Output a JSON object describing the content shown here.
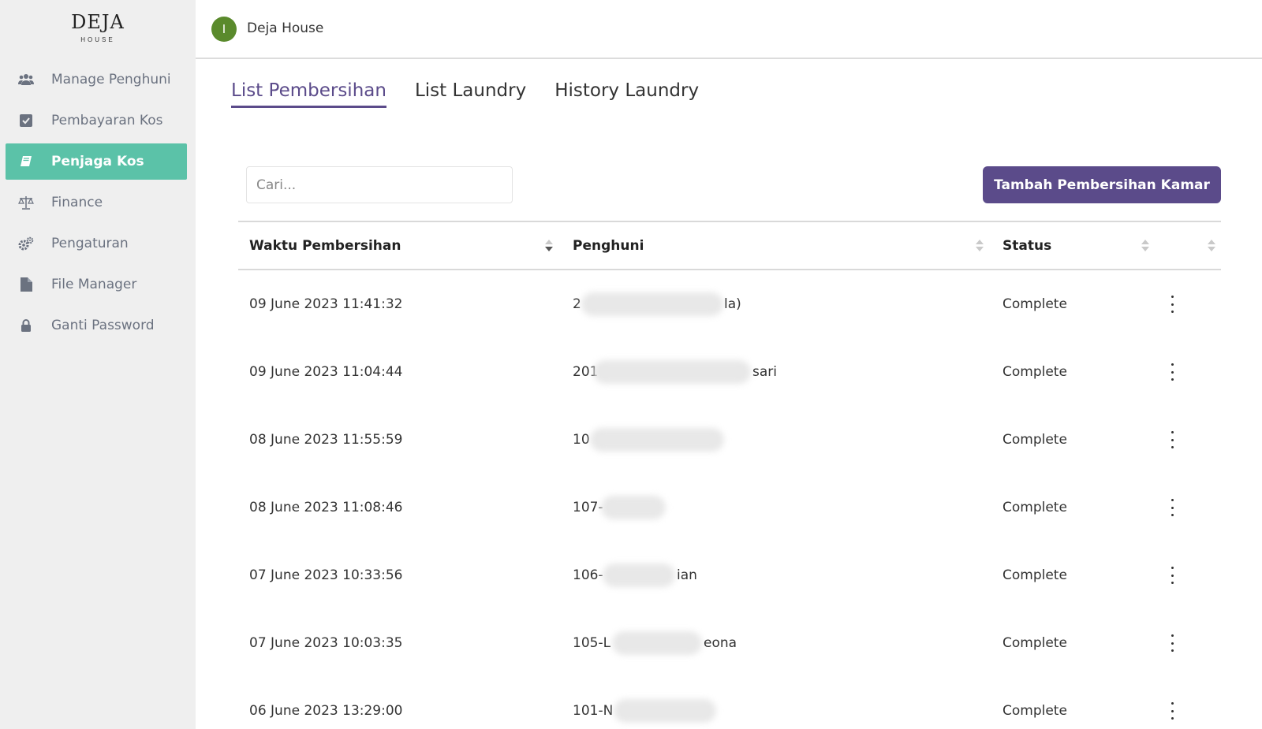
{
  "brand": {
    "name": "DEJA",
    "sub": "HOUSE"
  },
  "header": {
    "avatar_letter": "I",
    "title": "Deja House"
  },
  "sidebar": {
    "items": [
      {
        "label": "Manage Penghuni",
        "icon": "users-icon"
      },
      {
        "label": "Pembayaran Kos",
        "icon": "check-square-icon"
      },
      {
        "label": "Penjaga Kos",
        "icon": "book-icon",
        "active": true
      },
      {
        "label": "Finance",
        "icon": "scale-icon"
      },
      {
        "label": "Pengaturan",
        "icon": "gears-icon"
      },
      {
        "label": "File Manager",
        "icon": "file-icon"
      },
      {
        "label": "Ganti Password",
        "icon": "lock-icon"
      }
    ]
  },
  "tabs": [
    {
      "label": "List Pembersihan",
      "active": true
    },
    {
      "label": "List Laundry"
    },
    {
      "label": "History Laundry"
    }
  ],
  "search": {
    "placeholder": "Cari..."
  },
  "add_button": {
    "label": "Tambah Pembersihan Kamar"
  },
  "table": {
    "columns": [
      "Waktu Pembersihan",
      "Penghuni",
      "Status"
    ],
    "rows": [
      {
        "time": "09 June 2023 11:41:32",
        "tenant_start": "2",
        "tenant_end": "la)",
        "status": "Complete"
      },
      {
        "time": "09 June 2023 11:04:44",
        "tenant_start": "201",
        "tenant_end": "sari",
        "status": "Complete"
      },
      {
        "time": "08 June 2023 11:55:59",
        "tenant_start": "10",
        "tenant_end": "",
        "status": "Complete"
      },
      {
        "time": "08 June 2023 11:08:46",
        "tenant_start": "107-",
        "tenant_end": "",
        "status": "Complete"
      },
      {
        "time": "07 June 2023 10:33:56",
        "tenant_start": "106-",
        "tenant_end": "ian",
        "status": "Complete"
      },
      {
        "time": "07 June 2023 10:03:35",
        "tenant_start": "105-L",
        "tenant_end": "eona",
        "status": "Complete"
      },
      {
        "time": "06 June 2023 13:29:00",
        "tenant_start": "101-N",
        "tenant_end": "",
        "status": "Complete"
      }
    ]
  },
  "colors": {
    "accent": "#5b4b8a",
    "active_nav": "#5bc2a8",
    "avatar": "#5a8a2c"
  }
}
